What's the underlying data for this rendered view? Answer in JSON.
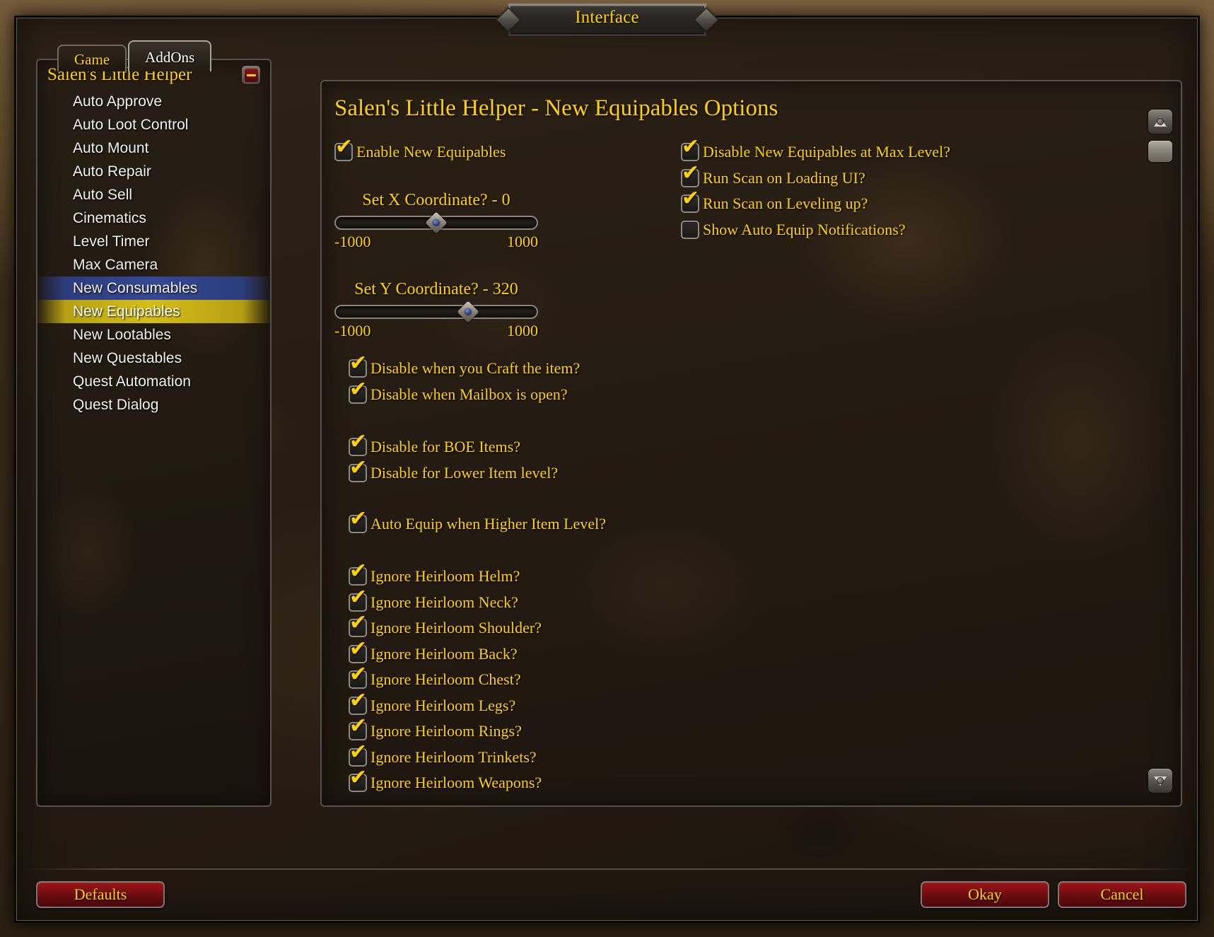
{
  "window": {
    "title": "Interface"
  },
  "tabs": [
    {
      "label": "Game",
      "active": false
    },
    {
      "label": "AddOns",
      "active": true
    }
  ],
  "sidebar": {
    "addon_title": "Salen's Little Helper",
    "collapse_icon": "minus-icon",
    "items": [
      {
        "label": "Auto Approve",
        "state": "normal"
      },
      {
        "label": "Auto Loot Control",
        "state": "normal"
      },
      {
        "label": "Auto Mount",
        "state": "normal"
      },
      {
        "label": "Auto Repair",
        "state": "normal"
      },
      {
        "label": "Auto Sell",
        "state": "normal"
      },
      {
        "label": "Cinematics",
        "state": "normal"
      },
      {
        "label": "Level Timer",
        "state": "normal"
      },
      {
        "label": "Max Camera",
        "state": "normal"
      },
      {
        "label": "New Consumables",
        "state": "highlight-blue"
      },
      {
        "label": "New Equipables",
        "state": "highlight-gold"
      },
      {
        "label": "New Lootables",
        "state": "normal"
      },
      {
        "label": "New Questables",
        "state": "normal"
      },
      {
        "label": "Quest Automation",
        "state": "normal"
      },
      {
        "label": "Quest Dialog",
        "state": "normal"
      }
    ]
  },
  "panel": {
    "title": "Salen's Little Helper - New Equipables Options",
    "enable_checkbox": {
      "label": "Enable New Equipables",
      "checked": true
    },
    "sliders": [
      {
        "title": "Set X Coordinate? - 0",
        "value": 0,
        "min": -1000,
        "max": 1000,
        "min_label": "-1000",
        "max_label": "1000"
      },
      {
        "title": "Set Y Coordinate? - 320",
        "value": 320,
        "min": -1000,
        "max": 1000,
        "min_label": "-1000",
        "max_label": "1000"
      }
    ],
    "left_options_group_1": [
      {
        "label": "Disable when you Craft the item?",
        "checked": true
      },
      {
        "label": "Disable when Mailbox is open?",
        "checked": true
      }
    ],
    "left_options_group_2": [
      {
        "label": "Disable for BOE Items?",
        "checked": true
      },
      {
        "label": "Disable for Lower Item level?",
        "checked": true
      }
    ],
    "left_options_group_3": [
      {
        "label": "Auto Equip when Higher Item Level?",
        "checked": true
      }
    ],
    "heirloom_options": [
      {
        "label": "Ignore Heirloom Helm?",
        "checked": true
      },
      {
        "label": "Ignore Heirloom Neck?",
        "checked": true
      },
      {
        "label": "Ignore Heirloom Shoulder?",
        "checked": true
      },
      {
        "label": "Ignore Heirloom Back?",
        "checked": true
      },
      {
        "label": "Ignore Heirloom Chest?",
        "checked": true
      },
      {
        "label": "Ignore Heirloom Legs?",
        "checked": true
      },
      {
        "label": "Ignore Heirloom Rings?",
        "checked": true
      },
      {
        "label": "Ignore Heirloom Trinkets?",
        "checked": true
      },
      {
        "label": "Ignore Heirloom Weapons?",
        "checked": true
      }
    ],
    "right_options": [
      {
        "label": "Disable New Equipables at Max Level?",
        "checked": true
      },
      {
        "label": "Run Scan on Loading UI?",
        "checked": true
      },
      {
        "label": "Run Scan on Leveling up?",
        "checked": true
      },
      {
        "label": "Show Auto Equip Notifications?",
        "checked": false
      }
    ],
    "scroll": {
      "up_icon": "scroll-up-icon",
      "down_icon": "scroll-down-icon",
      "thumb_icon": "scroll-thumb"
    }
  },
  "footer": {
    "defaults_label": "Defaults",
    "okay_label": "Okay",
    "cancel_label": "Cancel"
  },
  "colors": {
    "gold_text": "#ffd100",
    "white_text": "#f2f0ec",
    "highlight_blue": "#344894",
    "highlight_gold": "#d6be16",
    "button_red": "#7d1013"
  }
}
